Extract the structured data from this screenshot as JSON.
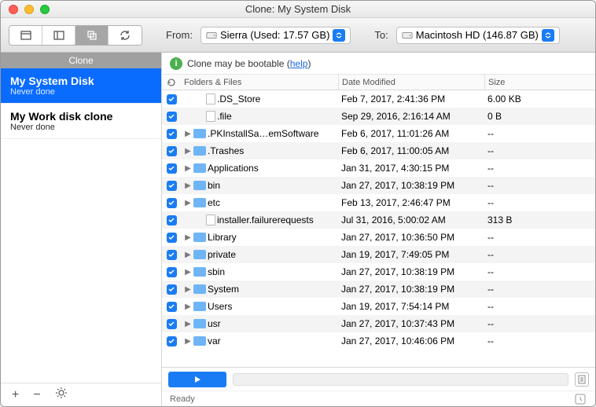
{
  "window": {
    "title": "Clone: My System Disk"
  },
  "sidebar": {
    "header": "Clone",
    "tasks": [
      {
        "name": "My System Disk",
        "status": "Never done",
        "selected": true
      },
      {
        "name": "My Work disk clone",
        "status": "Never done",
        "selected": false
      }
    ]
  },
  "source": {
    "label": "From:",
    "value": "Sierra (Used: 17.57 GB)"
  },
  "dest": {
    "label": "To:",
    "value": "Macintosh HD (146.87 GB)"
  },
  "info": {
    "text": "Clone may be bootable (",
    "link": "help",
    "suffix": ")"
  },
  "columns": {
    "c1": "Folders & Files",
    "c2": "Date Modified",
    "c3": "Size"
  },
  "rows": [
    {
      "name": ".DS_Store",
      "date": "Feb 7, 2017, 2:41:36 PM",
      "size": "6.00 KB",
      "folder": false,
      "expandable": false
    },
    {
      "name": ".file",
      "date": "Sep 29, 2016, 2:16:14 AM",
      "size": "0 B",
      "folder": false,
      "expandable": false
    },
    {
      "name": ".PKInstallSa…emSoftware",
      "date": "Feb 6, 2017, 11:01:26 AM",
      "size": "--",
      "folder": true,
      "expandable": true,
      "color": "#6fb5f6"
    },
    {
      "name": ".Trashes",
      "date": "Feb 6, 2017, 11:00:05 AM",
      "size": "--",
      "folder": true,
      "expandable": true,
      "color": "#6fb5f6"
    },
    {
      "name": "Applications",
      "date": "Jan 31, 2017, 4:30:15 PM",
      "size": "--",
      "folder": true,
      "expandable": true,
      "color": "#6fb5f6"
    },
    {
      "name": "bin",
      "date": "Jan 27, 2017, 10:38:19 PM",
      "size": "--",
      "folder": true,
      "expandable": true,
      "color": "#6fb5f6"
    },
    {
      "name": "etc",
      "date": "Feb 13, 2017, 2:46:47 PM",
      "size": "--",
      "folder": true,
      "expandable": true,
      "color": "#6fb5f6"
    },
    {
      "name": "installer.failurerequests",
      "date": "Jul 31, 2016, 5:00:02 AM",
      "size": "313 B",
      "folder": false,
      "expandable": false
    },
    {
      "name": "Library",
      "date": "Jan 27, 2017, 10:36:50 PM",
      "size": "--",
      "folder": true,
      "expandable": true,
      "color": "#6fb5f6"
    },
    {
      "name": "private",
      "date": "Jan 19, 2017, 7:49:05 PM",
      "size": "--",
      "folder": true,
      "expandable": true,
      "color": "#6fb5f6"
    },
    {
      "name": "sbin",
      "date": "Jan 27, 2017, 10:38:19 PM",
      "size": "--",
      "folder": true,
      "expandable": true,
      "color": "#6fb5f6"
    },
    {
      "name": "System",
      "date": "Jan 27, 2017, 10:38:19 PM",
      "size": "--",
      "folder": true,
      "expandable": true,
      "color": "#6fb5f6"
    },
    {
      "name": "Users",
      "date": "Jan 19, 2017, 7:54:14 PM",
      "size": "--",
      "folder": true,
      "expandable": true,
      "color": "#6fb5f6"
    },
    {
      "name": "usr",
      "date": "Jan 27, 2017, 10:37:43 PM",
      "size": "--",
      "folder": true,
      "expandable": true,
      "color": "#6fb5f6"
    },
    {
      "name": "var",
      "date": "Jan 27, 2017, 10:46:06 PM",
      "size": "--",
      "folder": true,
      "expandable": true,
      "color": "#6fb5f6"
    }
  ],
  "status": "Ready"
}
